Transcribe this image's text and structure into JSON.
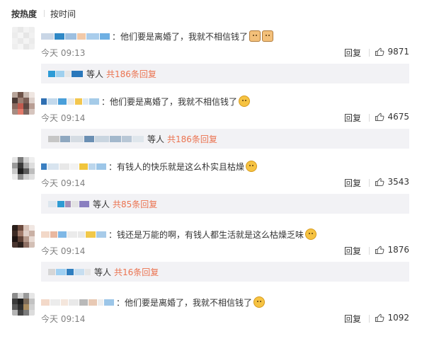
{
  "sort": {
    "hot": "按热度",
    "time": "按时间"
  },
  "comments": [
    {
      "text": "：他们要是离婚了，我就不相信钱了",
      "emojis": [
        "cat",
        "cat"
      ],
      "time": "今天 09:13",
      "reply": "回复",
      "likes": "9871",
      "reply_suffix": "等人",
      "reply_count": "共186条回复"
    },
    {
      "text": "：他们要是离婚了，我就不相信钱了",
      "emojis": [
        "smile"
      ],
      "time": "今天 09:14",
      "reply": "回复",
      "likes": "4675",
      "reply_suffix": "等人",
      "reply_count": "共186条回复"
    },
    {
      "text": "：有钱人的快乐就是这么朴实且枯燥",
      "emojis": [
        "laugh"
      ],
      "time": "今天 09:14",
      "reply": "回复",
      "likes": "3543",
      "reply_suffix": "等人",
      "reply_count": "共85条回复"
    },
    {
      "text": "：钱还是万能的啊，有钱人都生活就是这么枯燥乏味",
      "emojis": [
        "sad"
      ],
      "time": "今天 09:14",
      "reply": "回复",
      "likes": "1876",
      "reply_suffix": "等人",
      "reply_count": "共16条回复"
    },
    {
      "text": "：他们要是离婚了，我就不相信钱了",
      "emojis": [
        "smile"
      ],
      "time": "今天 09:14",
      "reply": "回复",
      "likes": "1092"
    }
  ],
  "colors": {
    "reply_count": "#eb7350",
    "meta_gray": "#808080",
    "reply_bg": "#f2f2f5"
  },
  "icons": {
    "like": "thumb-up-icon",
    "emoji": "emoji-icon"
  }
}
